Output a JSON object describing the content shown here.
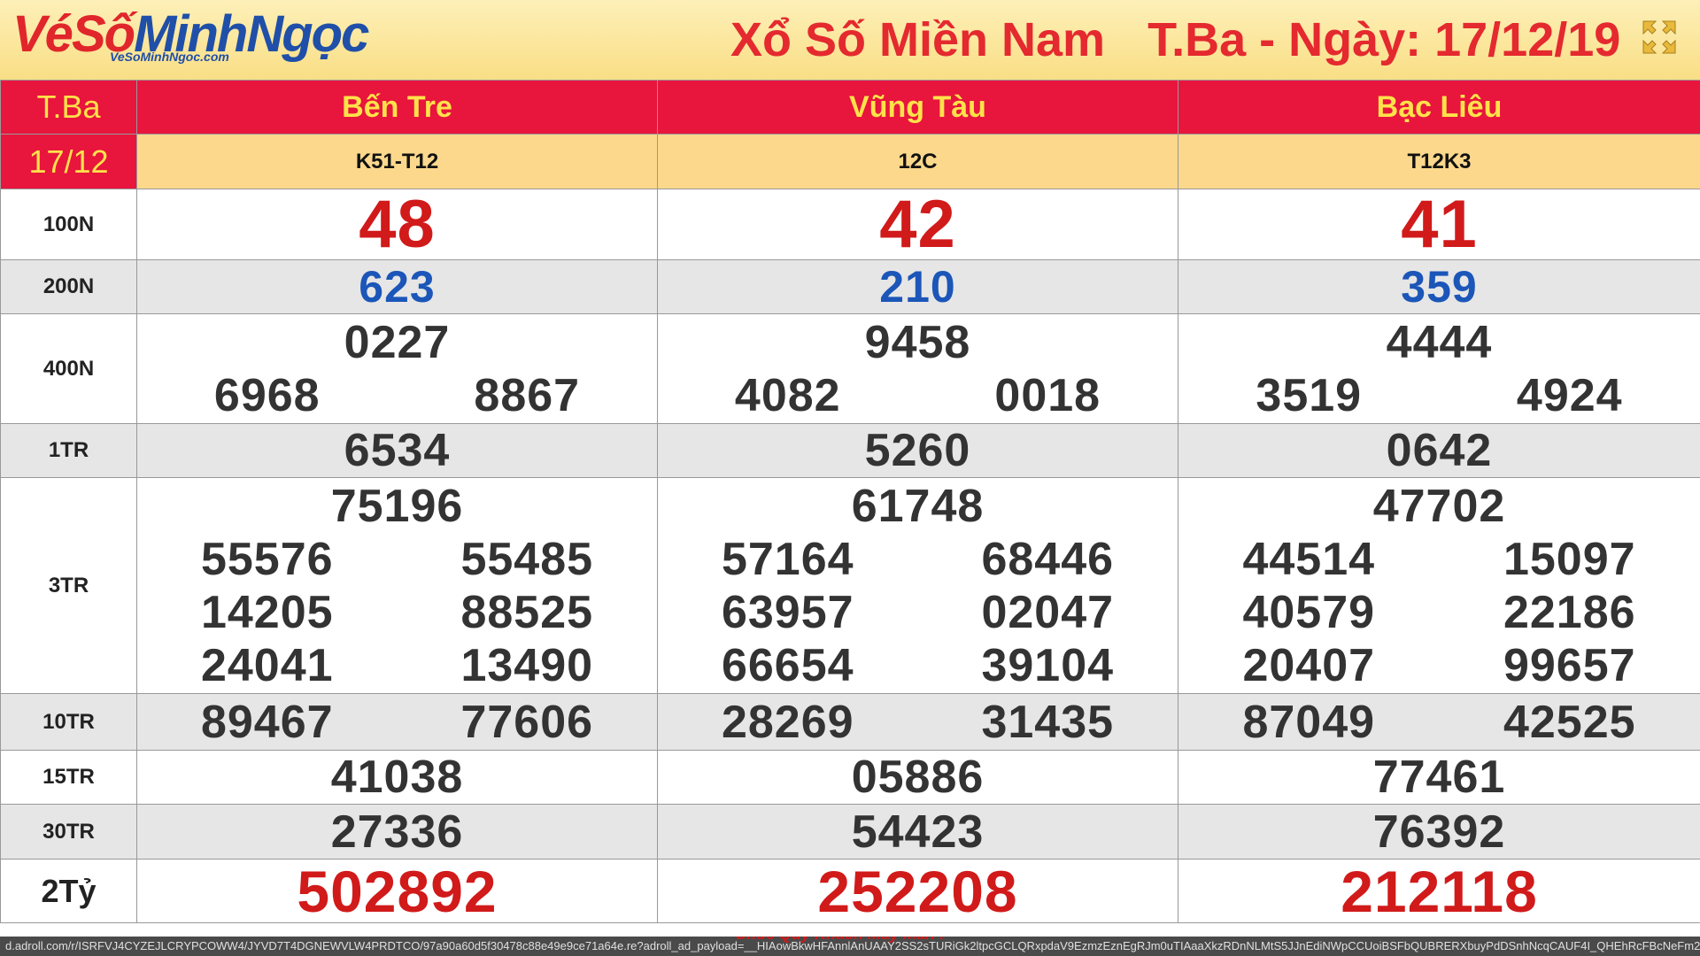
{
  "header": {
    "logo_ve": "Vé",
    "logo_so": "Số",
    "logo_mn": "MinhNgọc",
    "logo_sub": "VeSoMinhNgoc.com",
    "title_region": "Xổ Số Miền Nam",
    "title_date": "T.Ba - Ngày: 17/12/19",
    "fullscreen_icon": "fullscreen-icon"
  },
  "table": {
    "day": "T.Ba",
    "date": "17/12",
    "provinces": [
      {
        "name": "Bến Tre",
        "code": "K51-T12"
      },
      {
        "name": "Vũng Tàu",
        "code": "12C"
      },
      {
        "name": "Bạc Liêu",
        "code": "T12K3"
      }
    ],
    "prizes": {
      "p100n": {
        "label": "100N",
        "values": [
          "48",
          "42",
          "41"
        ]
      },
      "p200n": {
        "label": "200N",
        "values": [
          "623",
          "210",
          "359"
        ]
      },
      "p400n": {
        "label": "400N",
        "values": [
          [
            "0227",
            "6968",
            "8867"
          ],
          [
            "9458",
            "4082",
            "0018"
          ],
          [
            "4444",
            "3519",
            "4924"
          ]
        ]
      },
      "p1tr": {
        "label": "1TR",
        "values": [
          "6534",
          "5260",
          "0642"
        ]
      },
      "p3tr": {
        "label": "3TR",
        "values": [
          [
            "75196",
            "55576",
            "55485",
            "14205",
            "88525",
            "24041",
            "13490"
          ],
          [
            "61748",
            "57164",
            "68446",
            "63957",
            "02047",
            "66654",
            "39104"
          ],
          [
            "47702",
            "44514",
            "15097",
            "40579",
            "22186",
            "20407",
            "99657"
          ]
        ]
      },
      "p10tr": {
        "label": "10TR",
        "values": [
          [
            "89467",
            "77606"
          ],
          [
            "28269",
            "31435"
          ],
          [
            "87049",
            "42525"
          ]
        ]
      },
      "p15tr": {
        "label": "15TR",
        "values": [
          "41038",
          "05886",
          "77461"
        ]
      },
      "p30tr": {
        "label": "30TR",
        "values": [
          "27336",
          "54423",
          "76392"
        ]
      },
      "p2ty": {
        "label": "2Tỷ",
        "values": [
          "502892",
          "252208",
          "212118"
        ]
      }
    }
  },
  "footer": {
    "url": "d.adroll.com/r/ISRFVJ4CYZEJLCRYPCOWW4/JYVD7T4DGNEWVLW4PRDTCO/97a90a60d5f30478c88e49e9ce71a64e.re?adroll_ad_payload=__HIAowBkwHFAnnlAnUAAY2SS2sTURiGk2ltpcGCLQRxpdaV9EzmzEznEgRJm0uTIAaaXkzRDnNLMtS5JJnEdiNWpCCUoiBSFbQUBRERXbuyPdDSnhNcqCAUF4I_QHEhRcFBcNeFm2_1fPC8vO_nEOhE0TRXGBfE7HBxlsMls9zsZ",
    "message": "Chúc Quý Khách May Mắn !"
  }
}
